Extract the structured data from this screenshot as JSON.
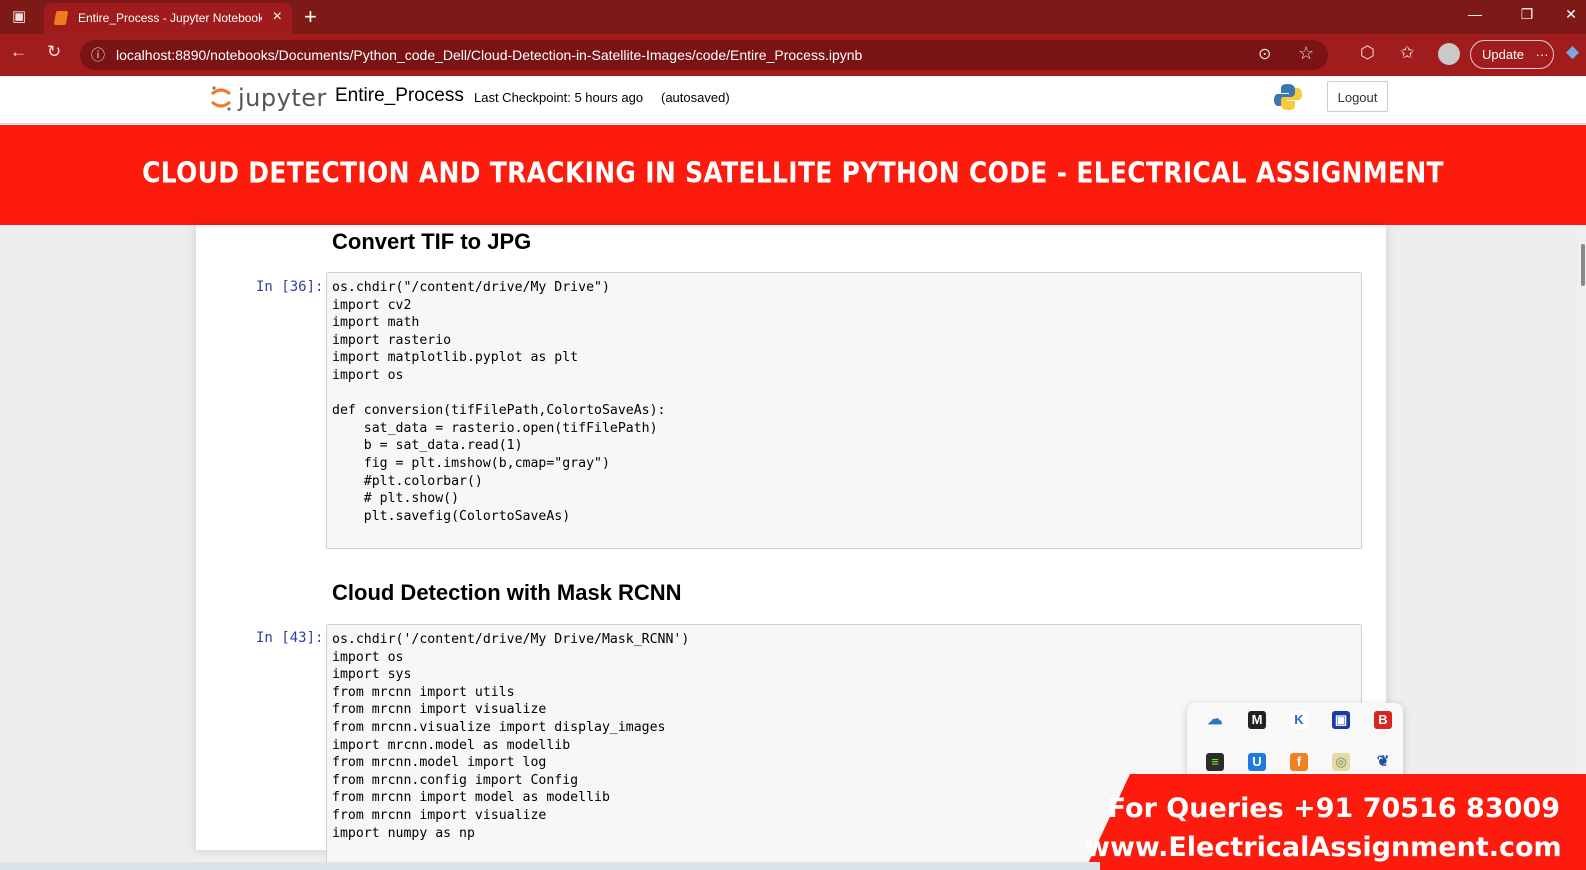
{
  "browser": {
    "tab_title": "Entire_Process - Jupyter Notebook",
    "tab_close": "×",
    "new_tab": "+",
    "url": "localhost:8890/notebooks/Documents/Python_code_Dell/Cloud-Detection-in-Satellite-Images/code/Entire_Process.ipynb",
    "update_label": "Update",
    "update_more": "···",
    "win_minimize": "—",
    "win_restore": "❐",
    "win_close": "✕"
  },
  "jupyter": {
    "logo_text": "jupyter",
    "notebook_name": "Entire_Process",
    "checkpoint": "Last Checkpoint: 5 hours ago",
    "autosave": "(autosaved)",
    "logout_label": "Logout"
  },
  "banner": {
    "text": "CLOUD DETECTION AND TRACKING IN SATELLITE PYTHON CODE - ELECTRICAL ASSIGNMENT"
  },
  "cells": [
    {
      "heading": "Convert TIF to JPG",
      "prompt": "In [36]:",
      "code": "os.chdir(\"/content/drive/My Drive\")\nimport cv2\nimport math\nimport rasterio\nimport matplotlib.pyplot as plt\nimport os\n\ndef conversion(tifFilePath,ColortoSaveAs):\n    sat_data = rasterio.open(tifFilePath)\n    b = sat_data.read(1)\n    fig = plt.imshow(b,cmap=\"gray\")\n    #plt.colorbar()\n    # plt.show()\n    plt.savefig(ColortoSaveAs)\n"
    },
    {
      "heading": "Cloud Detection with Mask RCNN",
      "prompt": "In [43]:",
      "code": "os.chdir('/content/drive/My Drive/Mask_RCNN')\nimport os\nimport sys\nfrom mrcnn import utils\nfrom mrcnn import visualize\nfrom mrcnn.visualize import display_images\nimport mrcnn.model as modellib\nfrom mrcnn.model import log\nfrom mrcnn.config import Config\nfrom mrcnn import model as modellib\nfrom mrcnn import visualize\nimport numpy as np"
    }
  ],
  "promo": {
    "line1": "For Queries +91 70516 83009",
    "line2": "www.ElectricalAssignment.com"
  },
  "colors": {
    "chrome_dark": "#7d1a18",
    "chrome": "#a11c1c",
    "banner_red": "#fc1b0c",
    "prompt_blue": "#303f9f"
  }
}
